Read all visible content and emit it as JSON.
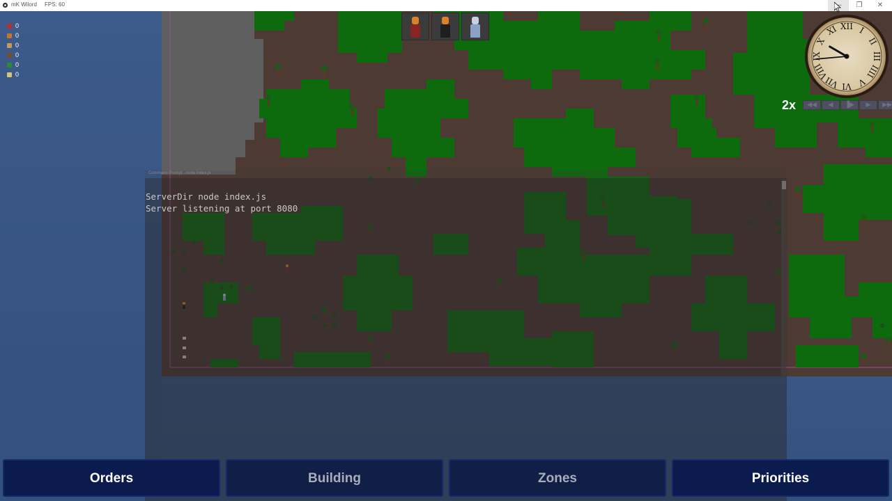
{
  "window": {
    "title": "mK Wilord",
    "fps": "FPS: 60",
    "controls": [
      "minimize",
      "maximize",
      "close"
    ]
  },
  "resources": [
    {
      "icon": "red-resource-icon",
      "value": "0",
      "color": "#b3312e"
    },
    {
      "icon": "orange-resource-icon",
      "value": "0",
      "color": "#c8732b"
    },
    {
      "icon": "tan-resource-icon",
      "value": "0",
      "color": "#c49a55"
    },
    {
      "icon": "brown-resource-icon",
      "value": "0",
      "color": "#7a4a2c"
    },
    {
      "icon": "green-resource-icon",
      "value": "0",
      "color": "#2f8a2f"
    },
    {
      "icon": "pale-resource-icon",
      "value": "0",
      "color": "#d7c47c"
    }
  ],
  "console": {
    "header": "Command Prompt - node index.js",
    "lines": [
      "ServerDir node index.js",
      "Server listening at port 8080"
    ]
  },
  "colonists": [
    {
      "name": "colonist-1",
      "shirt_color": "#8a2422",
      "head_color": "#d8822a"
    },
    {
      "name": "colonist-2",
      "shirt_color": "#1e1e1e",
      "head_color": "#d8822a"
    },
    {
      "name": "colonist-3",
      "shirt_color": "#8aa0c8",
      "head_color": "#c7d0dd"
    }
  ],
  "clock": {
    "numerals": [
      "XII",
      "I",
      "II",
      "III",
      "IIII",
      "V",
      "VI",
      "VII",
      "VIII",
      "IX",
      "X",
      "XI"
    ],
    "hour_angle": 300,
    "minute_angle": 265
  },
  "speed": {
    "label": "2x",
    "controls": [
      "◀◀",
      "◀",
      "▐▶",
      "▶",
      "▶▶"
    ]
  },
  "bottom_menu": [
    {
      "label": "Orders"
    },
    {
      "label": "Building"
    },
    {
      "label": "Zones"
    },
    {
      "label": "Priorities"
    }
  ],
  "colors": {
    "dirt": "#4d3a33",
    "grass": "#0e6a0e",
    "stone": "#5e5e5e",
    "menu_bg": "#0b1b4e"
  }
}
